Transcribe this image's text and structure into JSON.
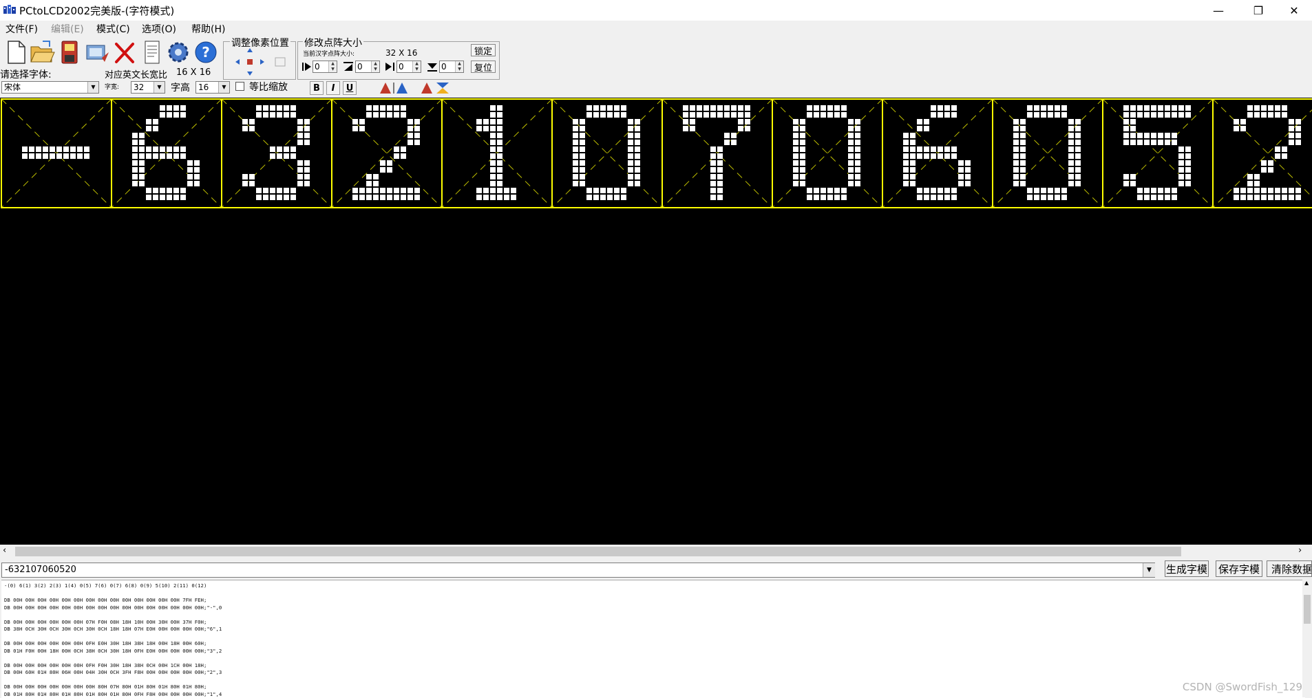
{
  "window": {
    "title": "PCtoLCD2002完美版-(字符模式)",
    "minimize_glyph": "—",
    "restore_glyph": "❐",
    "close_glyph": "✕"
  },
  "menu": [
    {
      "label": "文件(F)",
      "enabled": true
    },
    {
      "label": "编辑(E)",
      "enabled": false
    },
    {
      "label": "模式(C)",
      "enabled": true
    },
    {
      "label": "选项(O)",
      "enabled": true
    },
    {
      "label": "帮助(H)",
      "enabled": true
    }
  ],
  "toolbar": {
    "icons": [
      "new-file-icon",
      "open-folder-icon",
      "save-icon",
      "import-image-icon",
      "delete-icon",
      "notepad-icon",
      "settings-gear-icon",
      "help-icon"
    ],
    "pixel_adjust_title": "调整像素位置",
    "matrix_size_title": "修改点阵大小",
    "current_size_label": "当前汉字点阵大小:",
    "current_size_value": "32 X 16",
    "lock_label": "锁定",
    "reset_label": "复位",
    "spin_values": [
      "0",
      "0",
      "0",
      "0"
    ],
    "font_select_label": "请选择字体:",
    "font_value": "宋体",
    "ratio_label": "对应英文长宽比",
    "ratio_value": "16 X 16",
    "width_label": "字宽:",
    "width_value": "32",
    "height_label": "字高",
    "height_value": "16",
    "proportional_label": "等比缩放",
    "bold_label": "B",
    "italic_label": "I",
    "underline_label": "U"
  },
  "editor": {
    "characters": [
      "-",
      "6",
      "3",
      "2",
      "1",
      "0",
      "7",
      "0",
      "6",
      "0",
      "5",
      "2"
    ],
    "grid_color": "#ffff00",
    "dot_color": "#ffffff",
    "bg_color": "#000000"
  },
  "input": {
    "value": "-632107060520",
    "generate_label": "生成字模",
    "save_label": "保存字模",
    "clear_label": "清除数据"
  },
  "output_text": "-(0) 6(1) 3(2) 2(3) 1(4) 0(5) 7(6) 0(7) 6(8) 0(9) 5(10) 2(11) 0(12)\n\nDB 00H 00H 00H 00H 00H 00H 00H 00H 00H 00H 00H 00H 00H 00H 7FH FEH;\nDB 00H 00H 00H 00H 00H 00H 00H 00H 00H 00H 00H 00H 00H 00H 00H 00H;\"-\",0\n\nDB 00H 00H 00H 00H 00H 00H 07H F0H 08H 18H 10H 00H 30H 00H 37H F0H;\nDB 38H 0CH 30H 0CH 30H 0CH 30H 0CH 18H 18H 07H E0H 00H 00H 00H 00H;\"6\",1\n\nDB 00H 00H 00H 00H 00H 00H 0FH E0H 30H 18H 38H 18H 00H 18H 00H 60H;\nDB 01H F0H 00H 18H 00H 0CH 38H 0CH 30H 18H 0FH E0H 00H 00H 00H 00H;\"3\",2\n\nDB 00H 00H 00H 00H 00H 00H 0FH F0H 30H 18H 38H 0CH 00H 1CH 00H 18H;\nDB 00H 60H 01H 80H 06H 00H 04H 30H 0CH 3FH F8H 00H 00H 00H 00H 00H;\"2\",3\n\nDB 00H 00H 00H 00H 00H 00H 00H 80H 07H 80H 01H 80H 01H 80H 01H 80H;\nDB 01H 80H 01H 80H 01H 80H 01H 80H 01H 80H 0FH F8H 00H 00H 00H 00H;\"1\",4",
  "watermark": "CSDN @SwordFish_129"
}
